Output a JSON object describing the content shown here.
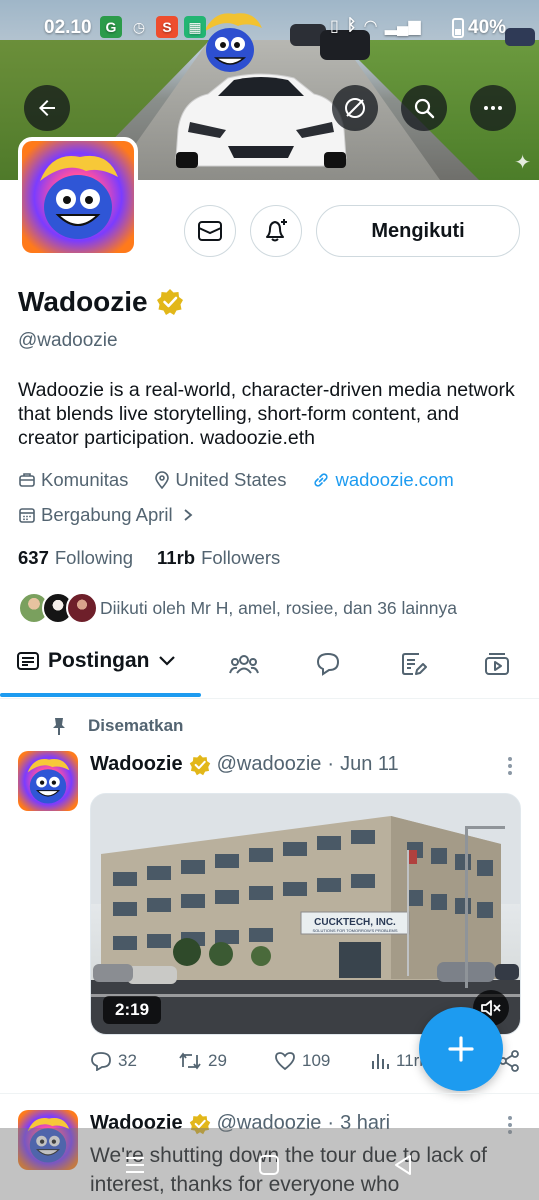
{
  "status_bar": {
    "time": "02.10",
    "battery": "40%",
    "icons": [
      "grab-icon",
      "alarm-icon",
      "shopee-icon",
      "app-grid-icon",
      "vibrate-icon",
      "bluetooth-icon",
      "wifi-icon",
      "signal-icon",
      "battery-icon"
    ]
  },
  "banner": {
    "buttons": [
      "back-arrow-icon",
      "translate-off-icon",
      "search-icon",
      "more-horizontal-icon"
    ]
  },
  "profile": {
    "name": "Wadoozie",
    "handle": "@wadoozie",
    "verified_color": "#e2b719",
    "bio": "Wadoozie is a real-world, character-driven media network that blends live storytelling, short-form content, and creator participation. wadoozie.eth",
    "category": "Komunitas",
    "location": "United States",
    "website": "wadoozie.com",
    "joined": "Bergabung April",
    "following_count": "637",
    "following_label": "Following",
    "followers_count": "11rb",
    "followers_label": "Followers",
    "followed_by": "Diikuti oleh Mr H, amel, rosiee, dan 36 lainnya",
    "follow_button": "Mengikuti"
  },
  "tabs": {
    "active_label": "Postingan",
    "icons": [
      "communities-icon",
      "replies-icon",
      "articles-icon",
      "media-icon"
    ]
  },
  "tweets": [
    {
      "pinned_label": "Disematkan",
      "name": "Wadoozie",
      "handle": "@wadoozie",
      "dot": "·",
      "date": "Jun 11",
      "video_duration": "2:19",
      "building_sign": "CUCKTECH, INC.",
      "building_subsign": "SOLUTIONS FOR TOMORROW'S PROBLEMS",
      "replies": "32",
      "reposts": "29",
      "likes": "109",
      "views": "11rb"
    },
    {
      "name": "Wadoozie",
      "handle": "@wadoozie",
      "dot": "·",
      "date": "3 hari",
      "text": "We're shutting down the tour due to lack of interest, thanks for everyone who"
    }
  ],
  "colors": {
    "accent": "#1d9bf0",
    "text": "#0f1419",
    "secondary": "#536471",
    "border": "#cfd9de"
  }
}
